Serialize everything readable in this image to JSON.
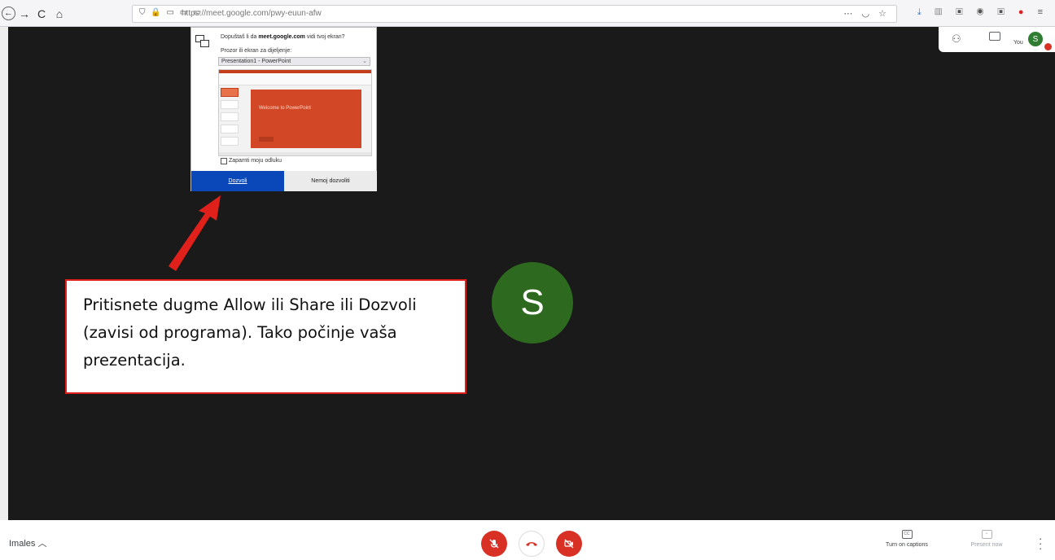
{
  "browser": {
    "url": "https://meet.google.com/pwy-euun-afw",
    "nav_back": "←",
    "nav_forward": "→",
    "nav_reload": "C",
    "nav_home": "⌂"
  },
  "share_dialog": {
    "question_prefix": "Dopuštaš li da ",
    "question_domain": "meet.google.com",
    "question_suffix": " vidi tvoj ekran?",
    "select_label": "Prozor ili ekran za dijeljenje:",
    "selected_window": "Presentation1 - PowerPoint",
    "preview_slide_title": "Welcome to PowerPoint",
    "remember_label": "Zapamti moju odluku",
    "allow_label": "Dozvoli",
    "deny_label": "Nemoj dozvoliti"
  },
  "meet": {
    "self_label": "You",
    "avatar_letter": "S",
    "meeting_name": "Imales",
    "captions_label": "Turn on captions",
    "present_label": "Present now"
  },
  "annotation": {
    "text": "Pritisnete dugme Allow ili Share ili Dozvoli (zavisi od programa). Tako počinje vaša prezentacija."
  },
  "colors": {
    "meet_bg": "#1a1a1a",
    "avatar_green": "#2d6a1f",
    "allow_blue": "#0a47b8",
    "annotation_red": "#e0201b",
    "mute_red": "#d93025"
  }
}
